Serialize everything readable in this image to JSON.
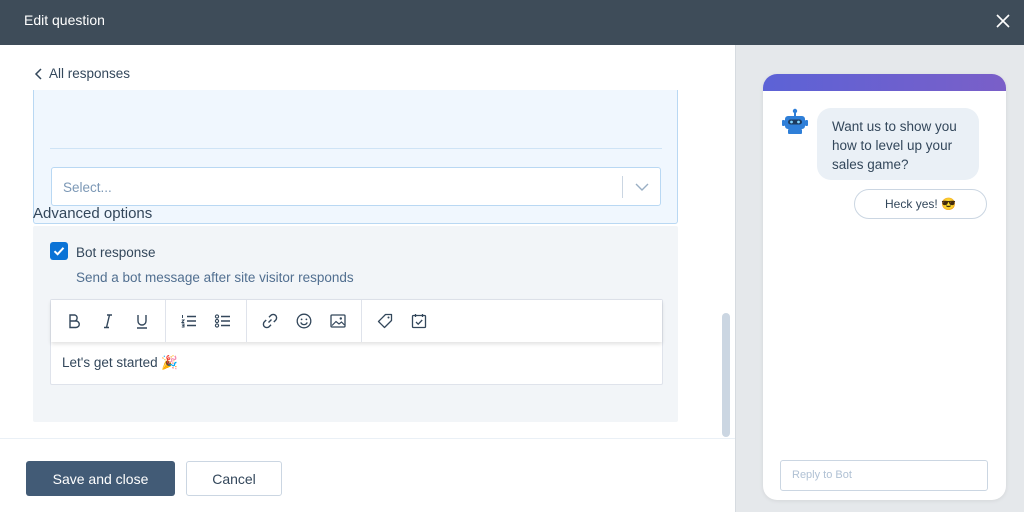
{
  "header": {
    "title": "Edit question"
  },
  "nav": {
    "back_label": "All responses"
  },
  "select": {
    "placeholder": "Select..."
  },
  "advanced": {
    "title": "Advanced options",
    "bot_response_label": "Bot response",
    "bot_response_checked": true,
    "bot_response_help": "Send a bot message after site visitor responds"
  },
  "editor": {
    "content": "Let's get started 🎉",
    "toolbar_icons": [
      "bold-icon",
      "italic-icon",
      "underline-icon",
      "numbered-list-icon",
      "bulleted-list-icon",
      "link-icon",
      "emoji-icon",
      "image-icon",
      "tag-icon",
      "calendar-check-icon"
    ]
  },
  "footer": {
    "save_label": "Save and close",
    "cancel_label": "Cancel"
  },
  "preview": {
    "bot_message": "Want us to show you how to level up your sales game?",
    "quick_reply": "Heck yes! 😎",
    "input_placeholder": "Reply to Bot"
  },
  "colors": {
    "topbar": "#3e4c59",
    "accent": "#0b73d6",
    "primary_button": "#425b76",
    "chat_header": "#6b60cf"
  }
}
